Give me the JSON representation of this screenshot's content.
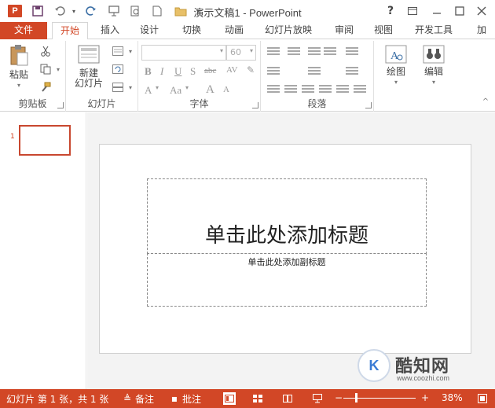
{
  "window": {
    "title": "演示文稿1 - PowerPoint",
    "app_icon": "P",
    "help": "?"
  },
  "quick_access": {
    "icons": [
      "save-icon",
      "undo-icon",
      "redo-icon",
      "presenter-icon",
      "preview-icon",
      "new-icon",
      "open-folder-icon",
      "customize-icon"
    ]
  },
  "tabs": [
    {
      "label": "文件"
    },
    {
      "label": "开始"
    },
    {
      "label": "插入"
    },
    {
      "label": "设计"
    },
    {
      "label": "切换"
    },
    {
      "label": "动画"
    },
    {
      "label": "幻灯片放映"
    },
    {
      "label": "审阅"
    },
    {
      "label": "视图"
    },
    {
      "label": "开发工具"
    },
    {
      "label": "加"
    }
  ],
  "ribbon": {
    "clipboard": {
      "paste_label": "粘贴",
      "group_label": "剪贴板"
    },
    "slides": {
      "new_slide_line1": "新建",
      "new_slide_line2": "幻灯片",
      "group_label": "幻灯片"
    },
    "font": {
      "font_size": "60",
      "group_label": "字体"
    },
    "paragraph": {
      "group_label": "段落"
    },
    "drawing": {
      "label": "绘图"
    },
    "editing": {
      "label": "编辑"
    }
  },
  "thumbnails": {
    "slide_number": "1"
  },
  "slide": {
    "title_placeholder": "单击此处添加标题",
    "subtitle_placeholder": "单击此处添加副标题"
  },
  "watermark": {
    "logo": "K",
    "name": "酷知网",
    "url": "www.coozhi.com"
  },
  "status_bar": {
    "slide_info": "幻灯片 第 1 张，共 1 张",
    "notes_label": "备注",
    "comments_label": "批注",
    "zoom_minus": "−",
    "zoom_plus": "+",
    "zoom_percent": "38%",
    "zoom_level": 0.38
  },
  "colors": {
    "accent": "#d24726"
  }
}
